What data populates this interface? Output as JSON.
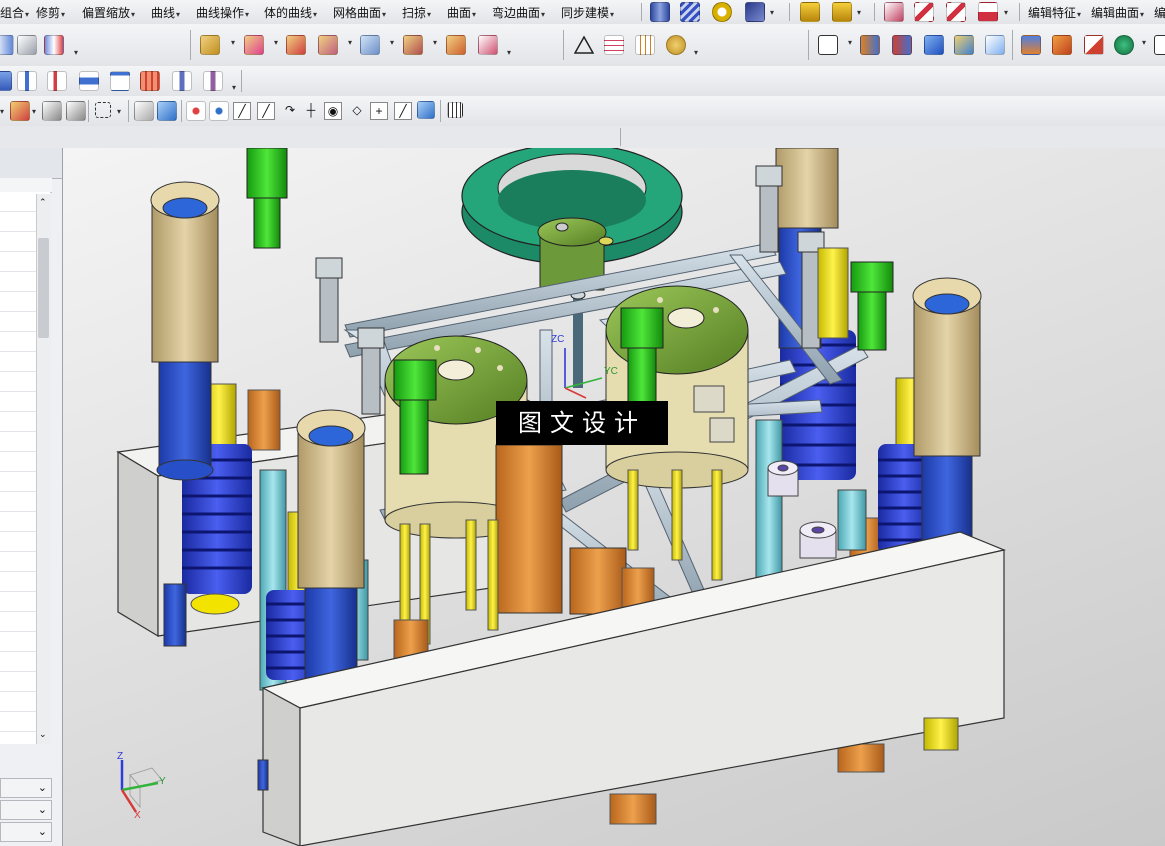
{
  "menu": {
    "items": [
      "组合",
      "修剪",
      "偏置缩放",
      "曲线",
      "曲线操作",
      "体的曲线",
      "网格曲面",
      "扫掠",
      "曲面",
      "弯边曲面",
      "同步建模",
      "编辑特征",
      "编辑曲面",
      "编"
    ]
  },
  "viewport": {
    "watermark": "图文设计",
    "axis_z": "Z",
    "axis_y": "Y",
    "axis_x": "X",
    "csys_zc": "ZC",
    "csys_yc": "YC"
  },
  "icons": {
    "menubar": [
      "cylinder-icon",
      "spring-icon",
      "ring-icon",
      "wire-edit-icon",
      "move-face-icon",
      "replace-face-icon",
      "blend-edit-icon",
      "curve-analysis-icon",
      "curve-deviation-icon"
    ],
    "toolbar2": [
      "boolean-icon",
      "extract-icon",
      "feature-icon",
      "unite-icon",
      "subtract-icon",
      "intersect-icon",
      "offset-icon",
      "trim-body-icon",
      "thicken-icon",
      "wrap-icon",
      "point-icon",
      "table-icon",
      "grid-icon",
      "pattern-icon",
      "sketch-icon",
      "block-icon",
      "cylinder-icon",
      "sphere-icon",
      "surface-icon",
      "patch-icon",
      "draft-icon",
      "sheet-icon",
      "measure-icon",
      "csys-icon",
      "frame-icon"
    ],
    "toolbar3": [
      "align-top-icon",
      "align-center-icon",
      "bracket-icon",
      "spacing-icon",
      "tee-icon",
      "grid-block-icon",
      "slot-icon",
      "bar-icon"
    ],
    "toolbar4": [
      "snap-icon",
      "filter-icon",
      "select-icon",
      "face-icon",
      "body-icon",
      "point-snap-icon",
      "endpoint-icon",
      "midpoint-icon",
      "curve-point-icon",
      "intersection-icon",
      "center-icon",
      "plus-icon",
      "tangent-icon",
      "quadrant-icon",
      "grid-snap-icon"
    ]
  },
  "colors": {
    "mold_plate": "#e4e4e2",
    "spring": "#2c3fd6",
    "pillar_tan": "#cdb88a",
    "rod_gray": "#b7c3cc",
    "bolt_green": "#26c21a",
    "ring_teal": "#1f9a72",
    "disc_olive": "#7aa83a",
    "pin_orange": "#d98b38",
    "pin_yellow": "#f0e000",
    "pin_cyan": "#7ecdd6"
  }
}
